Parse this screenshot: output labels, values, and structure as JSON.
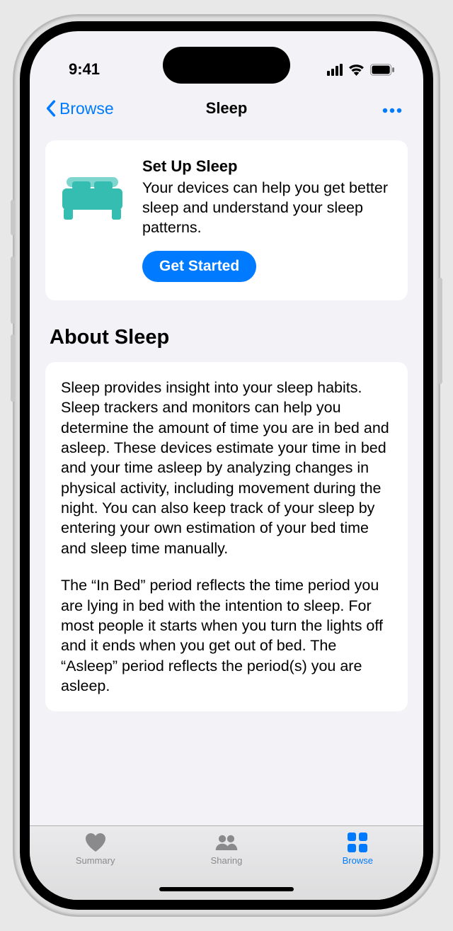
{
  "status": {
    "time": "9:41"
  },
  "nav": {
    "back": "Browse",
    "title": "Sleep"
  },
  "setup": {
    "title": "Set Up Sleep",
    "description": "Your devices can help you get better sleep and understand your sleep patterns.",
    "button": "Get Started"
  },
  "about": {
    "title": "About Sleep",
    "p1": "Sleep provides insight into your sleep habits. Sleep trackers and monitors can help you determine the amount of time you are in bed and asleep. These devices estimate your time in bed and your time asleep by analyzing changes in physical activity, including movement during the night. You can also keep track of your sleep by entering your own estimation of your bed time and sleep time manually.",
    "p2": "The “In Bed” period reflects the time period you are lying in bed with the intention to sleep. For most people it starts when you turn the lights off and it ends when you get out of bed. The “Asleep” period reflects the period(s) you are asleep."
  },
  "tabs": {
    "summary": "Summary",
    "sharing": "Sharing",
    "browse": "Browse"
  }
}
